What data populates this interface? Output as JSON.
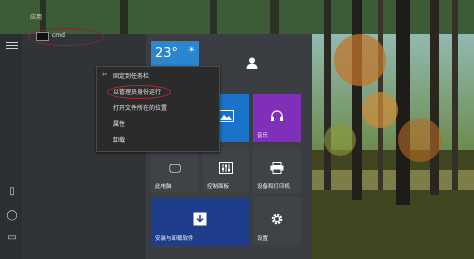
{
  "start_menu": {
    "section_label": "应用",
    "pinned_app": {
      "label": "cmd"
    }
  },
  "context_menu": {
    "items": [
      {
        "label": "固定到任务栏",
        "icon": "pin-icon"
      },
      {
        "label": "以管理员身份运行"
      },
      {
        "label": "打开文件所在的位置"
      },
      {
        "label": "属性"
      },
      {
        "label": "卸载"
      }
    ]
  },
  "tiles": {
    "weather": {
      "temp": "23°"
    },
    "user": {
      "icon": "user-icon"
    },
    "photos": {
      "icon": "image-icon"
    },
    "music": {
      "label": "音乐",
      "icon": "headphones-icon"
    },
    "pc": {
      "label": "此电脑"
    },
    "control_panel": {
      "label": "控制面板"
    },
    "devices_printers": {
      "label": "设备和打印机"
    },
    "programs_features": {
      "label": "安装与卸载软件"
    },
    "settings": {
      "label": "设置"
    }
  },
  "colors": {
    "accent_blue": "#1a72c9",
    "dark_blue": "#1e3d8a",
    "music_purple": "#7f2fb8",
    "highlight_red": "#b02a36"
  }
}
